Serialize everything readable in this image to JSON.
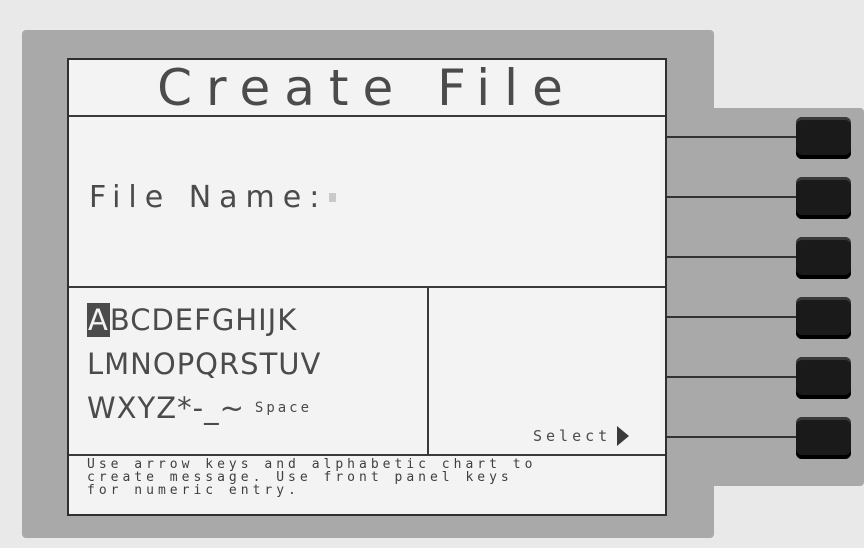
{
  "screen": {
    "title": "Create File",
    "file_name_label": "File Name:",
    "alphabet": {
      "selected_letter": "A",
      "row1_rest": "BCDEFGHIJK",
      "row2": "LMNOPQRSTUV",
      "row3": "WXYZ*-_~",
      "space_label": "Space"
    },
    "select_label": "Select",
    "help_lines": [
      "Use arrow keys and alphabetic chart to",
      "create message. Use front panel keys",
      "for numeric entry."
    ]
  },
  "softkeys": {
    "count": 6
  },
  "colors": {
    "screen_bg": "#f3f3f3",
    "text": "#4b4b4b",
    "bezel": "#a9a9a9",
    "key": "#1a1a1a"
  }
}
